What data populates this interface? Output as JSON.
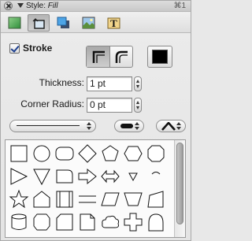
{
  "window": {
    "title_prefix": "Style: ",
    "title_style": "Fill",
    "shortcut": "⌘1"
  },
  "toolbar": {
    "buttons": [
      {
        "icon": "fill-swatch-icon",
        "selected": false
      },
      {
        "icon": "stroke-shape-icon",
        "selected": true
      },
      {
        "icon": "shadow-icon",
        "selected": false
      },
      {
        "icon": "image-icon",
        "selected": false
      },
      {
        "icon": "text-icon",
        "selected": false
      }
    ]
  },
  "stroke": {
    "label": "Stroke",
    "checked": true,
    "color": "#000000"
  },
  "fields": {
    "thickness_label": "Thickness:",
    "thickness_value": "1 pt",
    "corner_radius_label": "Corner Radius:",
    "corner_radius_value": "0 pt"
  },
  "popups": {
    "line_style": "solid-line",
    "line_cap": "rounded-cap",
    "line_join": "miter-join"
  },
  "shapes": [
    "square",
    "circle",
    "rounded-rect",
    "diamond",
    "pentagon",
    "hexagon",
    "octagon",
    "right-triangle",
    "down-triangle",
    "tab-shape",
    "arrow-right",
    "double-arrow",
    "small-triangle",
    "arc",
    "star",
    "house",
    "double-border-rect",
    "horizontal-lines",
    "parallelogram",
    "trapezoid",
    "quad",
    "cylinder",
    "rounded-octagon",
    "tag-shape",
    "document",
    "cloud",
    "cross",
    "arch"
  ]
}
